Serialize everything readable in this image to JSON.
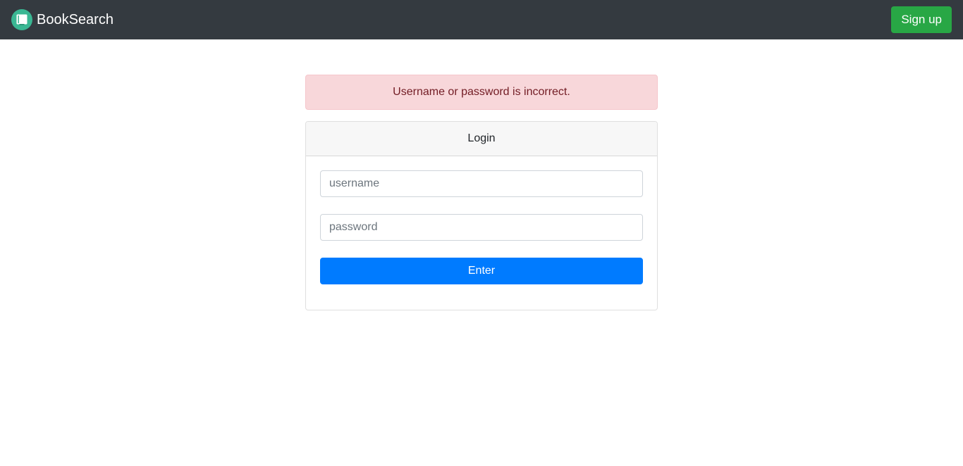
{
  "navbar": {
    "brand": "BookSearch",
    "brand_icon": "book-icon",
    "signup_label": "Sign up"
  },
  "alert": {
    "message": "Username or password is incorrect."
  },
  "login": {
    "title": "Login",
    "username_placeholder": "username",
    "username_value": "",
    "password_placeholder": "password",
    "password_value": "",
    "submit_label": "Enter"
  },
  "colors": {
    "navbar_bg": "#343a40",
    "signup_green": "#28a745",
    "logo_teal": "#3ab793",
    "alert_bg": "#f8d7da",
    "alert_text": "#721c24",
    "primary_blue": "#007bff"
  }
}
